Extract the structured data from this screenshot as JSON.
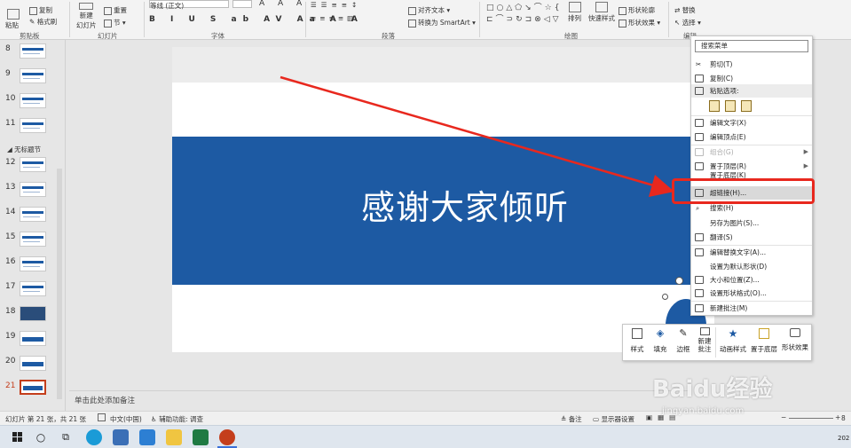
{
  "ribbon": {
    "paste": "粘贴",
    "copy": "复制",
    "format_painter": "格式刷",
    "new_slide_line1": "新建",
    "new_slide_line2": "幻灯片",
    "reset": "重置",
    "section": "节",
    "font_name": "等线 (正文)",
    "align_text": "对齐文本",
    "smartart": "转换为 SmartArt",
    "arrange": "排列",
    "quick_styles": "快速样式",
    "shape_outline": "形状轮廓",
    "shape_effects": "形状效果",
    "replace": "替换",
    "select": "选择",
    "groups": {
      "clipboard": "剪贴板",
      "slides": "幻灯片",
      "font": "字体",
      "paragraph": "段落",
      "drawing": "绘图",
      "editing": "编辑"
    }
  },
  "thumbs": {
    "section_label": "无标题节",
    "numbers": [
      "8",
      "9",
      "10",
      "11",
      "12",
      "13",
      "14",
      "15",
      "16",
      "17",
      "18",
      "19",
      "20",
      "21"
    ]
  },
  "slide": {
    "title": "感谢大家倾听"
  },
  "notes_placeholder": "单击此处添加备注",
  "context_menu": {
    "search": "搜索菜单",
    "items": {
      "cut": "剪切(T)",
      "copy": "复制(C)",
      "paste_options": "粘贴选项:",
      "edit_text": "编辑文字(X)",
      "edit_points": "编辑顶点(E)",
      "group": "组合(G)",
      "bring_to_front": "置于顶层(R)",
      "send_to_back": "置于底层(K)",
      "hyperlink": "超链接(H)...",
      "search": "搜索(H)",
      "save_as_picture": "另存为图片(S)...",
      "translate": "翻译(S)",
      "edit_alt_text": "编辑替换文字(A)...",
      "set_default_shape": "设置为默认形状(D)",
      "size_position": "大小和位置(Z)...",
      "format_shape": "设置形状格式(O)...",
      "new_comment": "新建批注(M)"
    }
  },
  "mini_toolbar": {
    "style": "样式",
    "fill": "填充",
    "outline": "边框",
    "new_comment_1": "新建",
    "new_comment_2": "批注",
    "animation": "动画样式",
    "bring_front": "置于底层",
    "shape_effects": "形状效果"
  },
  "status": {
    "slide_count": "幻灯片 第 21 张，共 21 张",
    "language": "中文(中国)",
    "accessibility": "辅助功能: 调查",
    "notes": "备注",
    "display_settings": "显示器设置",
    "zoom": "8"
  },
  "watermark": {
    "brand": "Baidu经验",
    "url": "jingyan.baidu.com"
  },
  "taskbar": {
    "clock": "202"
  },
  "colors": {
    "accent_blue": "#1d5aa3",
    "highlight_red": "#e8281e",
    "ppt_orange": "#c43e1c"
  }
}
